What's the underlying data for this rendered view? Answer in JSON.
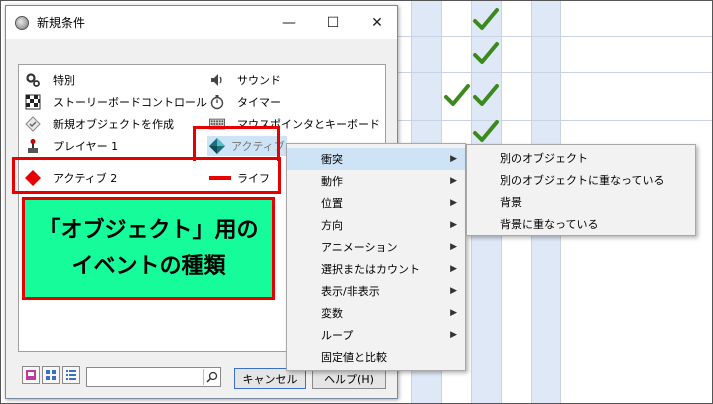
{
  "dialog": {
    "title": "新規条件",
    "buttons": {
      "minimize": "—",
      "maximize": "☐",
      "close": "✕"
    }
  },
  "list": {
    "items": [
      {
        "label": "特別",
        "icon": "gear-icon"
      },
      {
        "label": "サウンド",
        "icon": "speaker-icon"
      },
      {
        "label": "ストーリーボードコントロール",
        "icon": "checkered-flag-icon"
      },
      {
        "label": "タイマー",
        "icon": "stopwatch-icon"
      },
      {
        "label": "新規オブジェクトを作成",
        "icon": "new-object-icon"
      },
      {
        "label": "マウスポインタとキーボード",
        "icon": "keyboard-icon"
      },
      {
        "label": "プレイヤー 1",
        "icon": "joystick-icon"
      },
      {
        "label": "アクティブ",
        "icon": "teal-diamond-icon"
      },
      {
        "label": "アクティブ 2",
        "icon": "red-diamond-icon"
      },
      {
        "label": "ライフ",
        "icon": "red-line-icon"
      }
    ]
  },
  "toolbar": {
    "search_placeholder": "",
    "cancel_label": "キャンセル",
    "help_label": "ヘルプ(H)"
  },
  "caption": {
    "line1": "「オブジェクト」用の",
    "line2": "イベントの種類"
  },
  "menu": {
    "items": [
      {
        "label": "衝突",
        "submenu": true
      },
      {
        "label": "動作",
        "submenu": true
      },
      {
        "label": "位置",
        "submenu": true
      },
      {
        "label": "方向",
        "submenu": true
      },
      {
        "label": "アニメーション",
        "submenu": true
      },
      {
        "label": "選択またはカウント",
        "submenu": true
      },
      {
        "label": "表示/非表示",
        "submenu": true
      },
      {
        "label": "変数",
        "submenu": true
      },
      {
        "label": "ループ",
        "submenu": true
      },
      {
        "label": "固定値と比較",
        "submenu": false
      }
    ],
    "submenu_items": [
      {
        "label": "別のオブジェクト"
      },
      {
        "label": "別のオブジェクトに重なっている"
      },
      {
        "label": "背景"
      },
      {
        "label": "背景に重なっている"
      }
    ]
  },
  "colors": {
    "highlight_red": "#e60000",
    "caption_bg": "#17fc9b",
    "check_green": "#3c8a1e",
    "menu_hover": "#cfe3f7"
  }
}
